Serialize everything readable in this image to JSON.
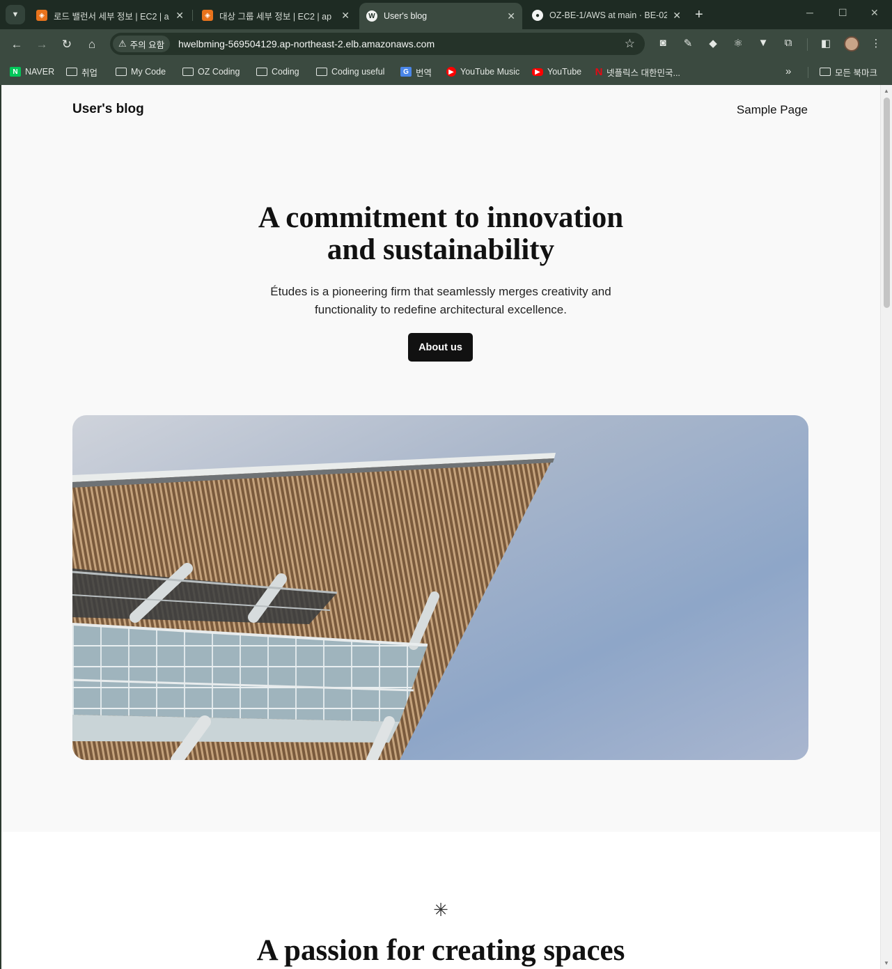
{
  "browser": {
    "tabs": [
      {
        "title": "로드 밸런서 세부 정보 | EC2 | a",
        "favicon": "aws-icon",
        "active": false
      },
      {
        "title": "대상 그룹 세부 정보 | EC2 | ap",
        "favicon": "aws-icon",
        "active": false
      },
      {
        "title": "User's blog",
        "favicon": "wordpress-icon",
        "active": true
      },
      {
        "title": "OZ-BE-1/AWS at main · BE-02-",
        "favicon": "github-icon",
        "active": false
      }
    ],
    "security_chip": "주의 요함",
    "url": "hwelbming-569504129.ap-northeast-2.elb.amazonaws.com",
    "bookmarks": [
      "NAVER",
      "취업",
      "My Code",
      "OZ Coding",
      "Coding",
      "Coding useful",
      "번역",
      "YouTube Music",
      "YouTube",
      "넷플릭스 대한민국..."
    ],
    "all_bookmarks": "모든 북마크",
    "accent_color": "#3b4a40"
  },
  "page": {
    "site_title": "User's blog",
    "nav_link": "Sample Page",
    "hero": {
      "heading_line1": "A commitment to innovation",
      "heading_line2": "and sustainability",
      "text_line1": "Études is a pioneering firm that seamlessly merges creativity and",
      "text_line2": "functionality to redefine architectural excellence.",
      "button": "About us"
    },
    "section2": {
      "separator": "✳",
      "heading": "A passion for creating spaces"
    }
  }
}
